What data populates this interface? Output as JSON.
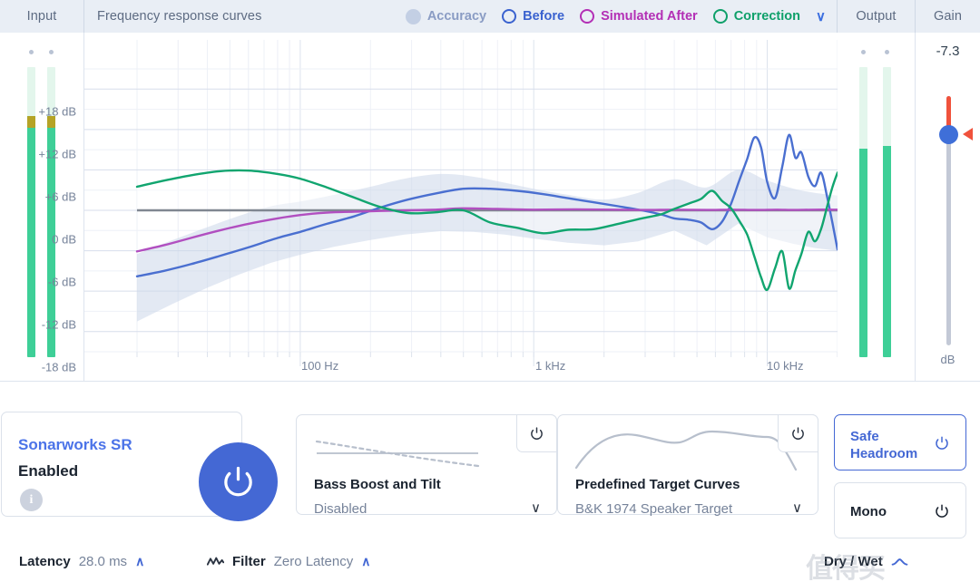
{
  "header": {
    "input_label": "Input",
    "title": "Frequency response curves",
    "output_label": "Output",
    "gain_label": "Gain",
    "caret": "∨",
    "legend": [
      {
        "label": "Accuracy",
        "color": "#8a9cc4",
        "marker": "filled-dot",
        "swatch": "#c3cfe4"
      },
      {
        "label": "Before",
        "color": "#3a62cf",
        "marker": "ring"
      },
      {
        "label": "Simulated After",
        "color": "#b32fb5",
        "marker": "ring"
      },
      {
        "label": "Correction",
        "color": "#0fa06a",
        "marker": "ring"
      }
    ]
  },
  "input_meters": {
    "channels": [
      {
        "id": "L",
        "badge_color": "#2b4590",
        "level_pct": 83,
        "peak_pct": 4
      },
      {
        "id": "R",
        "badge_color": "#4f7de0",
        "level_pct": 83,
        "peak_pct": 4
      }
    ]
  },
  "output_meters": {
    "channels": [
      {
        "id": "L",
        "badge_color": "#6c2a8c",
        "level_pct": 72,
        "peak_pct": 0
      },
      {
        "id": "R",
        "badge_color": "#ab3fcd",
        "level_pct": 73,
        "peak_pct": 0
      }
    ]
  },
  "gain": {
    "value": "-7.3",
    "unit": "dB",
    "over_color": "#f0523c",
    "knob_color": "#3f6fd8"
  },
  "chart_data": {
    "type": "line",
    "title": "Frequency response curves",
    "xlabel": "Frequency",
    "ylabel": "dB",
    "grid": true,
    "legend_position": "top-right",
    "xscale": "log",
    "xlim": [
      20,
      20000
    ],
    "ylim": [
      -21,
      21
    ],
    "xticks": [
      100,
      1000,
      10000
    ],
    "xticklabels": [
      "100 Hz",
      "1 kHz",
      "10 kHz"
    ],
    "yticks": [
      18,
      12,
      6,
      0,
      -6,
      -12,
      -18
    ],
    "yticklabels": [
      "+18 dB",
      "+12 dB",
      "+6 dB",
      "0 dB",
      "-6 dB",
      "-12 dB",
      "-18 dB"
    ],
    "series": [
      {
        "name": "Accuracy",
        "type": "band",
        "color": "#ccd7ea",
        "x": [
          20,
          28,
          40,
          55,
          75,
          100,
          140,
          200,
          280,
          400,
          550,
          750,
          1000,
          1400,
          2000,
          2800,
          4000,
          5500,
          7500,
          10000,
          13000,
          16000,
          20000
        ],
        "upper": [
          -6.5,
          -4.5,
          -2.5,
          -0.8,
          0.6,
          1.3,
          2.3,
          3.5,
          4.7,
          5.4,
          5.0,
          4.1,
          3.2,
          2.3,
          1.6,
          2.6,
          4.6,
          3.4,
          6.0,
          4.4,
          3.2,
          2.6,
          2.2
        ],
        "lower": [
          -16.5,
          -14.0,
          -11.5,
          -9.5,
          -7.8,
          -6.6,
          -5.4,
          -4.4,
          -3.6,
          -3.1,
          -3.2,
          -3.6,
          -4.2,
          -4.8,
          -5.2,
          -4.6,
          -3.0,
          -5.2,
          -2.0,
          -4.0,
          -5.0,
          -5.6,
          -6.0
        ]
      },
      {
        "name": "Before",
        "type": "line",
        "color": "#4a6fd0",
        "x": [
          20,
          26,
          34,
          45,
          60,
          80,
          100,
          130,
          170,
          220,
          290,
          380,
          500,
          650,
          850,
          1100,
          1400,
          1800,
          2300,
          2900,
          3500,
          4000,
          4600,
          5200,
          5800,
          6400,
          7000,
          7600,
          8200,
          8800,
          9400,
          10000,
          10800,
          11600,
          12400,
          13200,
          14000,
          15000,
          16000,
          17000,
          18000,
          19000,
          20000
        ],
        "y": [
          -9.8,
          -9.0,
          -8.0,
          -6.8,
          -5.5,
          -4.1,
          -3.2,
          -2.0,
          -0.9,
          0.4,
          1.6,
          2.5,
          3.2,
          3.2,
          2.9,
          2.4,
          1.8,
          1.2,
          0.6,
          0.0,
          -0.6,
          -1.2,
          -1.4,
          -1.8,
          -2.8,
          -1.7,
          1.0,
          4.5,
          7.6,
          10.8,
          9.4,
          4.2,
          1.8,
          6.5,
          11.2,
          7.8,
          8.6,
          5.0,
          3.6,
          5.6,
          2.2,
          -1.8,
          -5.8
        ]
      },
      {
        "name": "Simulated After",
        "type": "line",
        "color": "#b14fc0",
        "x": [
          20,
          26,
          34,
          45,
          60,
          80,
          100,
          130,
          170,
          220,
          290,
          380,
          500,
          700,
          1000,
          1500,
          2200,
          3000,
          4000,
          5500,
          7000,
          9000,
          11000,
          13000,
          16000,
          20000
        ],
        "y": [
          -6.1,
          -5.2,
          -4.1,
          -3.0,
          -2.0,
          -1.2,
          -0.7,
          -0.35,
          -0.2,
          -0.1,
          0.0,
          0.1,
          0.3,
          0.2,
          0.1,
          0.15,
          0.1,
          0.05,
          0.1,
          0.05,
          0.1,
          0.05,
          0.1,
          0.05,
          0.1,
          0.1
        ]
      },
      {
        "name": "Correction",
        "type": "line",
        "color": "#11a56f",
        "x": [
          20,
          26,
          34,
          45,
          60,
          80,
          100,
          130,
          170,
          220,
          290,
          380,
          500,
          650,
          850,
          1100,
          1400,
          1800,
          2300,
          2900,
          3500,
          4000,
          4600,
          5200,
          5800,
          6400,
          7000,
          7600,
          8200,
          8800,
          9400,
          10000,
          10800,
          11600,
          12400,
          13200,
          14000,
          15000,
          16000,
          17000,
          18000,
          19000,
          20000
        ],
        "y": [
          3.5,
          4.4,
          5.2,
          5.8,
          5.9,
          5.4,
          4.7,
          3.4,
          1.9,
          0.5,
          -0.4,
          -0.3,
          0.0,
          -1.8,
          -2.6,
          -3.4,
          -2.9,
          -2.8,
          -2.0,
          -1.2,
          -0.6,
          0.2,
          1.0,
          1.7,
          2.9,
          1.4,
          0.3,
          -1.6,
          -3.6,
          -6.8,
          -9.9,
          -11.8,
          -8.6,
          -6.1,
          -11.6,
          -8.9,
          -6.5,
          -3.2,
          -4.6,
          -2.8,
          0.4,
          3.4,
          5.6
        ]
      },
      {
        "name": "Zero line",
        "type": "reference",
        "color": "#808791",
        "y": 0
      }
    ]
  },
  "sonarworks_card": {
    "brand": "Sonarworks SR",
    "state": "Enabled",
    "info_glyph": "i",
    "power_icon": "power-icon"
  },
  "modules": [
    {
      "name": "bass-boost-and-tilt",
      "title": "Bass Boost and Tilt",
      "value": "Disabled",
      "caret": "∨",
      "power_icon": "power-icon"
    },
    {
      "name": "predefined-target-curves",
      "title": "Predefined Target Curves",
      "value": "B&K 1974 Speaker Target",
      "caret": "∨",
      "power_icon": "power-icon"
    }
  ],
  "toggles": [
    {
      "name": "safe-headroom",
      "label": "Safe\nHeadroom",
      "label_line1": "Safe",
      "label_line2": "Headroom",
      "active": true,
      "color": "#4468d4"
    },
    {
      "name": "mono",
      "label": "Mono",
      "label_line1": "Mono",
      "label_line2": "",
      "active": false,
      "color": "#1b2430"
    }
  ],
  "footer": {
    "latency_label": "Latency",
    "latency_value": "28.0 ms",
    "latency_caret": "∧",
    "filter_label": "Filter",
    "filter_value": "Zero Latency",
    "filter_caret": "∧",
    "drywet_label": "Dry / Wet"
  },
  "watermark": "值得买"
}
